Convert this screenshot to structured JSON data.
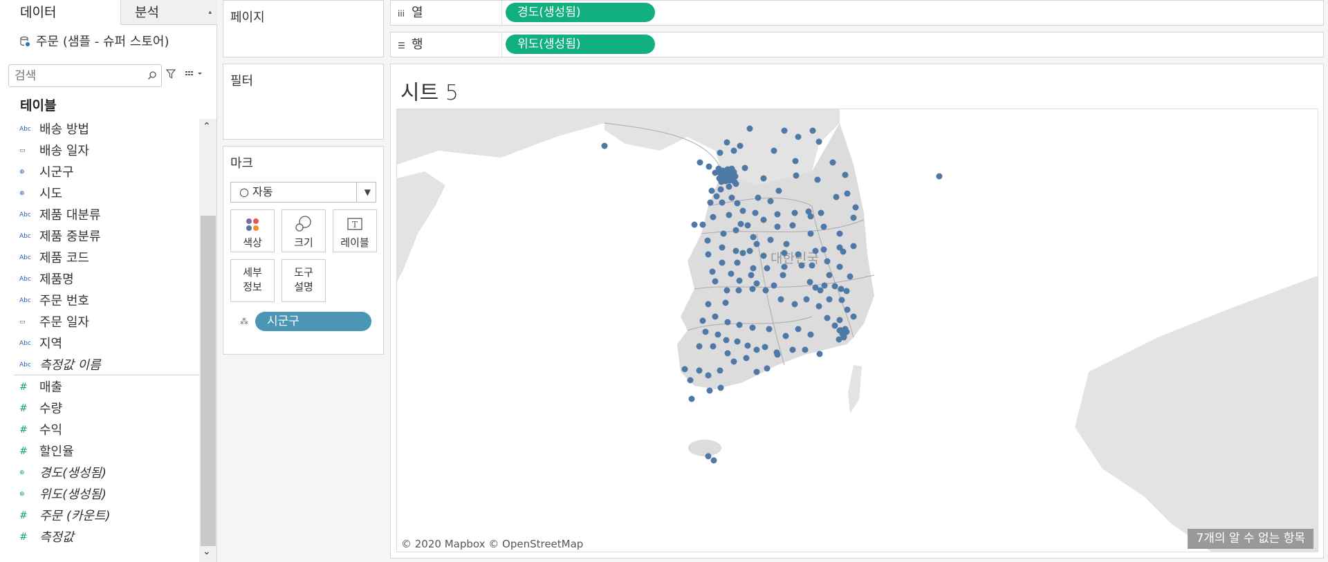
{
  "tabs": {
    "data": "데이터",
    "analytics": "분석"
  },
  "datasource": "주문 (샘플 - 슈퍼 스토어)",
  "search": {
    "placeholder": "검색"
  },
  "tables_header": "테이블",
  "dimensions": [
    {
      "type": "abc",
      "label": "배송 방법"
    },
    {
      "type": "date",
      "label": "배송 일자"
    },
    {
      "type": "geo",
      "label": "시군구"
    },
    {
      "type": "geo",
      "label": "시도"
    },
    {
      "type": "abc",
      "label": "제품 대분류"
    },
    {
      "type": "abc",
      "label": "제품 중분류"
    },
    {
      "type": "abc",
      "label": "제품 코드"
    },
    {
      "type": "abc",
      "label": "제품명"
    },
    {
      "type": "abc",
      "label": "주문 번호"
    },
    {
      "type": "date",
      "label": "주문 일자"
    },
    {
      "type": "abc",
      "label": "지역"
    },
    {
      "type": "abc",
      "label": "측정값 이름",
      "italic": true
    }
  ],
  "measures": [
    {
      "type": "num",
      "label": "매출"
    },
    {
      "type": "num",
      "label": "수량"
    },
    {
      "type": "num",
      "label": "수익"
    },
    {
      "type": "num",
      "label": "할인율"
    },
    {
      "type": "geo",
      "label": "경도(생성됨)",
      "italic": true
    },
    {
      "type": "geo",
      "label": "위도(생성됨)",
      "italic": true
    },
    {
      "type": "num",
      "label": "주문 (카운트)",
      "italic": true
    },
    {
      "type": "num",
      "label": "측정값",
      "italic": true
    }
  ],
  "pages_title": "페이지",
  "filters_title": "필터",
  "marks": {
    "title": "마크",
    "type_selected": "○ 자동",
    "buttons": [
      "색상",
      "크기",
      "레이블",
      "세부\n정보",
      "도구\n설명"
    ],
    "detail_pill": "시군구"
  },
  "columns": {
    "label": "열",
    "pill": "경도(생성됨)"
  },
  "rows": {
    "label": "행",
    "pill": "위도(생성됨)"
  },
  "sheet_title": "시트 5",
  "map": {
    "country_label": "대한민국",
    "attribution": "© 2020 Mapbox © OpenStreetMap",
    "unknown_items": "7개의 알 수 없는 항목",
    "marker_color": "#4e79a7"
  }
}
